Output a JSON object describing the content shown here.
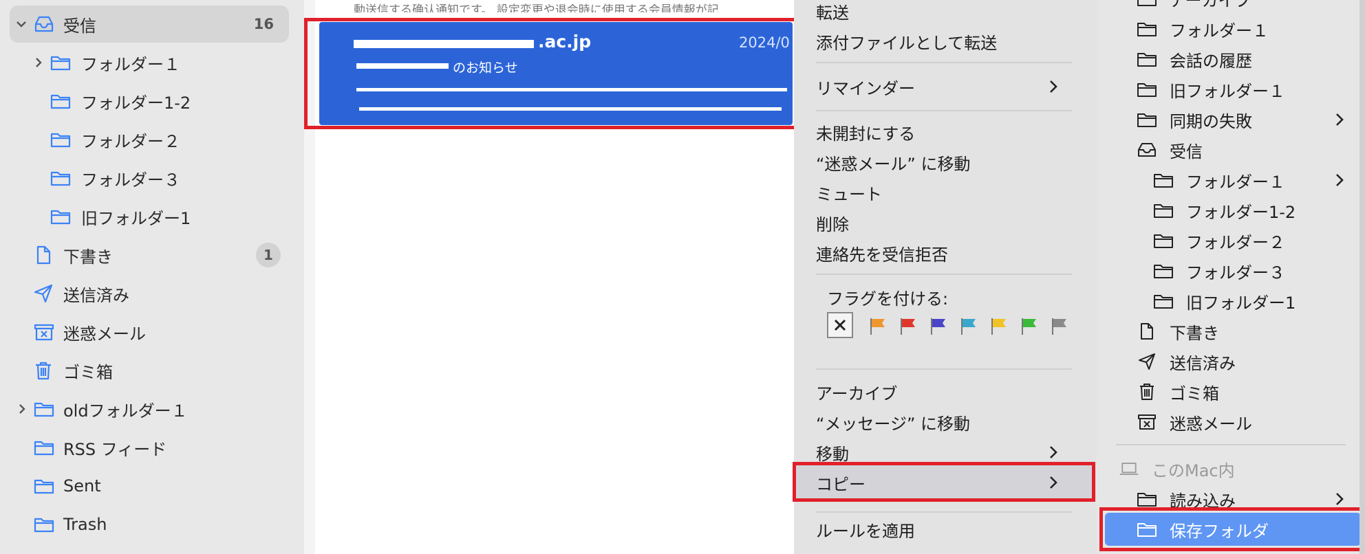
{
  "sidebar": {
    "inbox_label": "受信",
    "inbox_count": "16",
    "folder1": "フォルダー１",
    "folder1_2": "フォルダー1-2",
    "folder2": "フォルダー２",
    "folder3": "フォルダー３",
    "old_folder1": "旧フォルダー1",
    "drafts": "下書き",
    "drafts_count": "1",
    "sent": "送信済み",
    "junk": "迷惑メール",
    "trash": "ゴミ箱",
    "old_folder_en": "oldフォルダー１",
    "rss": "RSS フィード",
    "sent_en": "Sent",
    "trash_en": "Trash"
  },
  "messages": {
    "top_text": "動送信する确认通知です。 設定変更や退会時に使用する会員情報が記",
    "selected": {
      "sender": ".ac.jp",
      "date": "2024/0",
      "subject": "のお知らせ"
    }
  },
  "context_menu": {
    "forward": "転送",
    "forward_as_attachment": "添付ファイルとして転送",
    "reminder": "リマインダー",
    "mark_unread": "未開封にする",
    "move_to_junk": "“迷惑メール” に移動",
    "mute": "ミュート",
    "delete": "削除",
    "block_contact": "連絡先を受信拒否",
    "flag_label": "フラグを付ける:",
    "flag_colors": [
      "#f0962e",
      "#e0362c",
      "#4a44c8",
      "#3aa8cc",
      "#f2c326",
      "#3cba3c",
      "#8a8a8a"
    ],
    "archive": "アーカイブ",
    "move_to_messages": "“メッセージ” に移動",
    "move": "移動",
    "copy": "コピー",
    "apply_rules": "ルールを適用"
  },
  "submenu": {
    "top_cut": "アーカイブ",
    "folder1": "フォルダー１",
    "conversation_history": "会話の履歴",
    "old_folder1": "旧フォルダー１",
    "sync_failure": "同期の失敗",
    "inbox": "受信",
    "inbox_folder1": "フォルダー１",
    "inbox_folder1_2": "フォルダー1-2",
    "inbox_folder2": "フォルダー２",
    "inbox_folder3": "フォルダー３",
    "inbox_old_folder1": "旧フォルダー1",
    "drafts": "下書き",
    "sent": "送信済み",
    "trash": "ゴミ箱",
    "junk": "迷惑メール",
    "on_my_mac": "このMac内",
    "imports": "読み込み",
    "saved_folder": "保存フォルダ"
  },
  "colors": {
    "accent": "#2c64d8",
    "highlight_border": "#e0202a",
    "submenu_selection": "#5f96f4",
    "folder_icon": "#3b82f6"
  }
}
